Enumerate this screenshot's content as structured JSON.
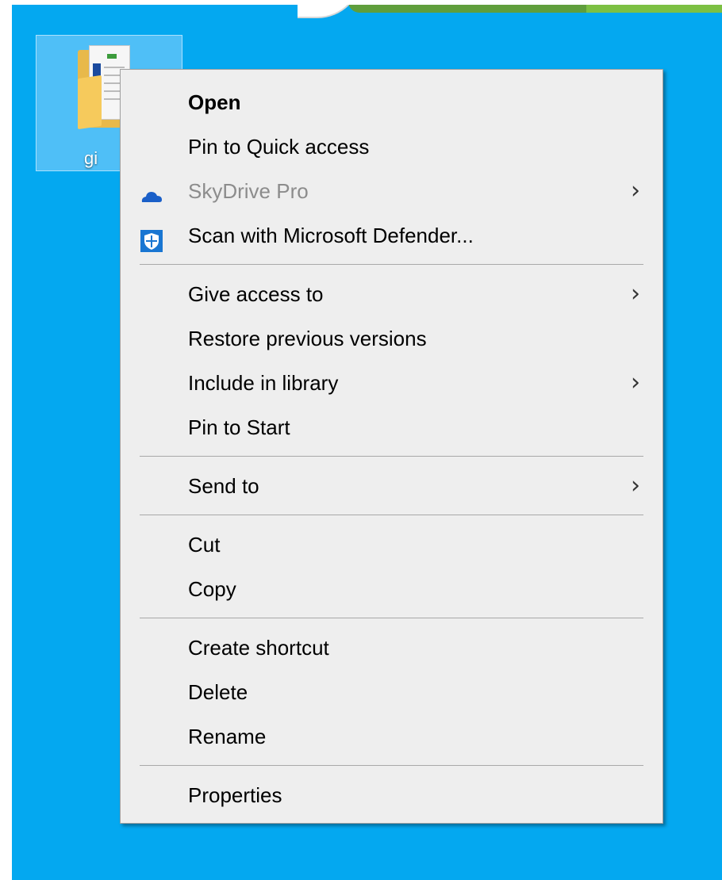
{
  "desktop": {
    "file_label": "gi"
  },
  "menu": {
    "open": "Open",
    "pin_quick_access": "Pin to Quick access",
    "skydrive": "SkyDrive Pro",
    "scan_defender": "Scan with Microsoft Defender...",
    "give_access": "Give access to",
    "restore_versions": "Restore previous versions",
    "include_library": "Include in library",
    "pin_start": "Pin to Start",
    "send_to": "Send to",
    "cut": "Cut",
    "copy": "Copy",
    "create_shortcut": "Create shortcut",
    "delete": "Delete",
    "rename": "Rename",
    "properties": "Properties"
  },
  "icons": {
    "skydrive": "cloud-icon",
    "defender": "shield-icon",
    "submenu": "chevron-right-icon"
  },
  "colors": {
    "desktop_bg": "#04a8f0",
    "menu_bg": "#eeeeee",
    "disabled_text": "#8c8c8c",
    "accent_blue": "#1a5fc8"
  }
}
